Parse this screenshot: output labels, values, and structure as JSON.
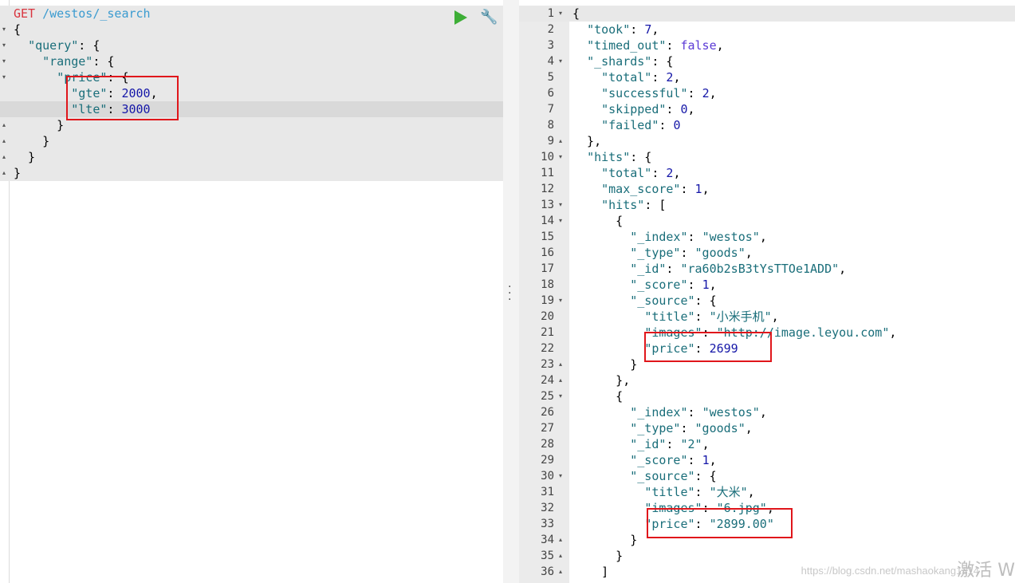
{
  "request": {
    "method": "GET",
    "path": "/westos/_search",
    "lines": [
      "{",
      "  \"query\": {",
      "    \"range\": {",
      "      \"price\": {",
      "        \"gte\": 2000,",
      "        \"lte\": 3000",
      "      }",
      "    }",
      "  }",
      "}"
    ]
  },
  "toolbar": {
    "run_icon": "play-icon",
    "settings_icon": "wrench-icon"
  },
  "response": {
    "lines": [
      "{",
      "  \"took\": 7,",
      "  \"timed_out\": false,",
      "  \"_shards\": {",
      "    \"total\": 2,",
      "    \"successful\": 2,",
      "    \"skipped\": 0,",
      "    \"failed\": 0",
      "  },",
      "  \"hits\": {",
      "    \"total\": 2,",
      "    \"max_score\": 1,",
      "    \"hits\": [",
      "      {",
      "        \"_index\": \"westos\",",
      "        \"_type\": \"goods\",",
      "        \"_id\": \"ra60b2sB3tYsTTOe1ADD\",",
      "        \"_score\": 1,",
      "        \"_source\": {",
      "          \"title\": \"小米手机\",",
      "          \"images\": \"http://image.leyou.com\",",
      "          \"price\": 2699",
      "        }",
      "      },",
      "      {",
      "        \"_index\": \"westos\",",
      "        \"_type\": \"goods\",",
      "        \"_id\": \"2\",",
      "        \"_score\": 1,",
      "        \"_source\": {",
      "          \"title\": \"大米\",",
      "          \"images\": \"6.jpg\",",
      "          \"price\": \"2899.00\"",
      "        }",
      "      }",
      "    ]"
    ]
  },
  "watermark": "https://blog.csdn.net/mashaokang1314",
  "activate_text": "激活 W",
  "colors": {
    "highlight_box": "#e0161b",
    "run_button": "#3dae36"
  }
}
